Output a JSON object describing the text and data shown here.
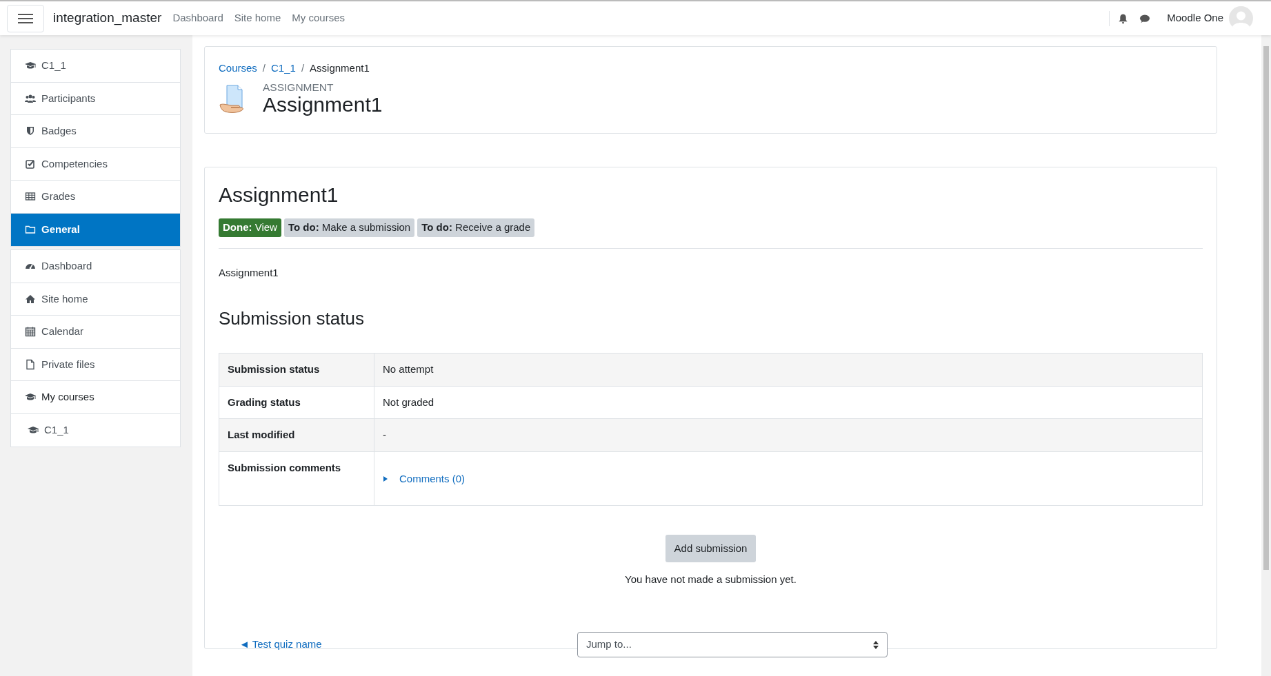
{
  "navbar": {
    "site_name": "integration_master",
    "links": [
      "Dashboard",
      "Site home",
      "My courses"
    ],
    "user_name": "Moodle One"
  },
  "sidebar": {
    "groups": [
      {
        "items": [
          {
            "label": "C1_1",
            "selected": false
          },
          {
            "label": "Participants",
            "selected": false
          },
          {
            "label": "Badges",
            "selected": false
          },
          {
            "label": "Competencies",
            "selected": false
          },
          {
            "label": "Grades",
            "selected": false
          },
          {
            "label": "General",
            "selected": true
          }
        ]
      },
      {
        "items": [
          {
            "label": "Dashboard",
            "selected": false
          },
          {
            "label": "Site home",
            "selected": false
          },
          {
            "label": "Calendar",
            "selected": false
          },
          {
            "label": "Private files",
            "selected": false
          },
          {
            "label": "My courses",
            "selected": false,
            "children": [
              {
                "label": "C1_1",
                "selected": false
              }
            ]
          }
        ]
      }
    ]
  },
  "header": {
    "breadcrumb": [
      {
        "kind": "link",
        "text": "Courses"
      },
      {
        "kind": "separator",
        "text": "/"
      },
      {
        "kind": "link",
        "text": "C1_1"
      },
      {
        "kind": "separator",
        "text": "/"
      },
      {
        "kind": "current",
        "text": "Assignment1"
      }
    ],
    "module_type": "ASSIGNMENT",
    "title": "Assignment1"
  },
  "activity": {
    "title": "Assignment1",
    "completion": [
      {
        "kind": "done",
        "label": "Done:",
        "text": "View"
      },
      {
        "kind": "todo",
        "label": "To do:",
        "text": "Make a submission"
      },
      {
        "kind": "todo",
        "label": "To do:",
        "text": "Receive a grade"
      }
    ],
    "description": "Assignment1",
    "status_heading": "Submission status",
    "status_rows": [
      {
        "label": "Submission status",
        "value": "No attempt"
      },
      {
        "label": "Grading status",
        "value": "Not graded"
      },
      {
        "label": "Last modified",
        "value": "-"
      },
      {
        "label": "Submission comments",
        "comments_link": "Comments (0)",
        "expanded": false
      }
    ],
    "add_button": "Add submission",
    "note": "You have not made a submission yet."
  },
  "footer_nav": {
    "previous": "◄ Test quiz name",
    "jump_placeholder": "Jump to..."
  }
}
